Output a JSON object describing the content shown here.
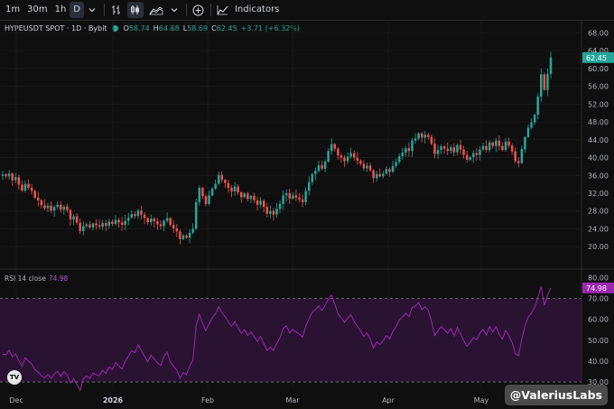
{
  "toolbar": {
    "intervals": [
      "1m",
      "30m",
      "1h",
      "D"
    ],
    "active_interval": "D",
    "indicators_label": "Indicators"
  },
  "legend": {
    "symbol": "HYPEUSDT SPOT · 1D · Bybit",
    "open_label": "O",
    "open": "58.74",
    "high_label": "H",
    "high": "64.68",
    "low_label": "L",
    "low": "58.69",
    "close_label": "C",
    "close": "62.45",
    "change": "+3.71 (+6.32%)"
  },
  "rsi_legend": {
    "label": "RSI 14 close",
    "value": "74.98"
  },
  "watermark": "@ValeriusLabs",
  "colors": {
    "background": "#0f0f0f",
    "up": "#26a69a",
    "down": "#ef5350",
    "rsi_line": "#9c27b0",
    "rsi_band": "#2a1233",
    "last_price_tag": "#26a69a",
    "rsi_tag": "#9c27b0"
  },
  "chart_data": [
    {
      "type": "candlestick",
      "price_axis": {
        "ticks": [
          "68.00",
          "64.00",
          "60.00",
          "56.00",
          "52.00",
          "48.00",
          "44.00",
          "40.00",
          "36.00",
          "32.00",
          "28.00",
          "24.00",
          "20.00"
        ],
        "ylim": [
          17.6,
          68.9
        ],
        "last_price": "62.45"
      },
      "time_axis": {
        "ticks": [
          "Dec",
          "2026",
          "Feb",
          "Mar",
          "Apr",
          "May"
        ]
      },
      "close_series": [
        36.2,
        35.8,
        36.4,
        34.9,
        35.6,
        33.9,
        32.6,
        34.1,
        33.2,
        32.5,
        31.0,
        30.4,
        29.3,
        28.6,
        29.2,
        28.1,
        28.9,
        29.4,
        28.3,
        29.0,
        28.2,
        26.1,
        26.8,
        25.4,
        23.5,
        24.6,
        25.0,
        24.3,
        25.2,
        24.8,
        24.5,
        25.3,
        24.7,
        25.6,
        25.1,
        26.0,
        25.4,
        24.9,
        25.8,
        26.5,
        27.3,
        26.9,
        28.1,
        27.2,
        26.4,
        25.5,
        26.3,
        25.7,
        25.0,
        24.6,
        25.8,
        26.4,
        24.9,
        24.1,
        23.4,
        21.7,
        22.5,
        22.0,
        23.1,
        24.0,
        30.0,
        33.2,
        31.3,
        29.6,
        31.5,
        33.0,
        34.1,
        36.1,
        35.0,
        34.3,
        33.2,
        32.4,
        33.5,
        32.2,
        31.1,
        31.9,
        30.7,
        31.4,
        30.4,
        29.4,
        30.3,
        28.9,
        27.4,
        28.0,
        27.2,
        28.5,
        29.6,
        31.5,
        32.0,
        30.8,
        31.5,
        31.0,
        30.6,
        30.0,
        32.5,
        34.5,
        36.3,
        37.0,
        38.3,
        37.5,
        39.1,
        41.5,
        43.0,
        42.0,
        40.5,
        40.0,
        39.2,
        40.2,
        41.0,
        40.0,
        39.3,
        38.6,
        37.6,
        38.2,
        37.1,
        35.4,
        36.3,
        35.8,
        36.4,
        37.4,
        36.8,
        38.1,
        39.0,
        40.3,
        41.1,
        42.1,
        41.5,
        43.8,
        44.3,
        45.4,
        44.5,
        45.1,
        44.6,
        43.1,
        40.8,
        41.7,
        42.5,
        42.0,
        41.5,
        42.3,
        41.2,
        42.8,
        41.8,
        40.6,
        39.5,
        40.1,
        41.0,
        40.6,
        41.8,
        42.6,
        41.7,
        43.4,
        42.6,
        43.8,
        42.6,
        41.7,
        43.6,
        42.7,
        41.4,
        39.2,
        38.8,
        41.9,
        44.6,
        46.7,
        47.9,
        49.6,
        53.7,
        58.7,
        55.2,
        58.8,
        62.5
      ],
      "rsi_axis": {
        "ticks": [
          "80.00",
          "70.00",
          "60.00",
          "50.00",
          "40.00",
          "30.00"
        ],
        "ylim": [
          27,
          81
        ],
        "upper_band": 70,
        "lower_band": 30,
        "last_value": "74.98"
      },
      "rsi_series": [
        43.3,
        43.0,
        45.2,
        42.1,
        43.5,
        40.1,
        37.5,
        41.6,
        39.9,
        38.6,
        35.8,
        34.8,
        33.0,
        31.9,
        33.6,
        31.7,
        33.8,
        35.1,
        32.7,
        34.9,
        33.3,
        29.5,
        31.5,
        28.8,
        26.0,
        31.4,
        32.9,
        31.6,
        34.3,
        33.5,
        33.0,
        35.6,
        34.1,
        37.2,
        36.0,
        39.4,
        37.6,
        36.2,
        39.8,
        42.4,
        45.0,
        44.0,
        47.8,
        45.0,
        42.3,
        39.6,
        42.8,
        41.1,
        39.0,
        37.9,
        42.3,
        44.3,
        39.6,
        37.4,
        35.6,
        31.7,
        34.5,
        33.5,
        37.5,
        40.6,
        56.9,
        62.4,
        58.1,
        54.5,
        57.9,
        60.7,
        62.6,
        66.0,
        63.1,
        61.3,
        58.6,
        56.7,
        59.0,
        55.8,
        53.2,
        55.0,
        52.3,
        54.0,
        51.7,
        49.4,
        51.7,
        48.3,
        45.1,
        46.7,
        45.0,
        48.4,
        51.2,
        55.6,
        56.8,
        53.5,
        55.1,
        53.9,
        52.9,
        51.5,
        56.6,
        60.2,
        63.4,
        64.6,
        66.5,
        64.1,
        66.6,
        69.5,
        71.5,
        67.4,
        62.6,
        60.6,
        58.6,
        60.7,
        62.4,
        58.9,
        56.6,
        54.4,
        51.8,
        53.5,
        50.5,
        46.2,
        49.1,
        47.9,
        49.7,
        52.2,
        50.6,
        54.1,
        56.4,
        59.5,
        61.2,
        63.0,
        61.2,
        65.6,
        66.3,
        68.0,
        64.6,
        66.0,
        64.3,
        59.0,
        52.2,
        54.4,
        56.6,
        54.9,
        53.3,
        55.6,
        52.1,
        56.1,
        52.9,
        49.8,
        47.1,
        48.9,
        51.3,
        50.2,
        53.3,
        55.2,
        52.5,
        56.5,
        53.9,
        56.5,
        52.8,
        50.4,
        54.7,
        52.2,
        48.8,
        43.5,
        42.5,
        50.5,
        56.8,
        61.0,
        63.0,
        65.6,
        70.4,
        75.7,
        66.8,
        71.4,
        75.0
      ]
    }
  ]
}
